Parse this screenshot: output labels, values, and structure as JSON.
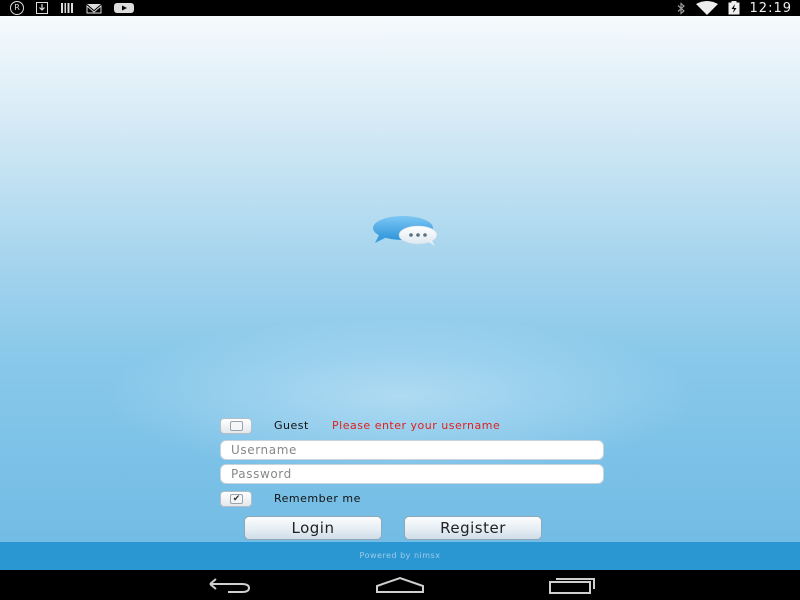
{
  "status_bar": {
    "time": "12:19",
    "left_icons": [
      "registered-icon",
      "download-icon",
      "barcode-icon",
      "mail-icon",
      "youtube-icon"
    ],
    "right_icons": [
      "bluetooth-icon",
      "wifi-icon",
      "battery-icon"
    ]
  },
  "form": {
    "guest_label": "Guest",
    "error_message": "Please enter your username",
    "username_placeholder": "Username",
    "password_placeholder": "Password",
    "remember_label": "Remember me",
    "guest_checked": false,
    "remember_checked": true,
    "login_label": "Login",
    "register_label": "Register"
  },
  "footer": {
    "powered_by": "Powered by nimsx"
  },
  "nav_bar": {
    "buttons": [
      "back-icon",
      "home-icon",
      "recent-apps-icon"
    ]
  },
  "colors": {
    "footer": "#2b97d2",
    "error": "#e0201c",
    "logo_bubble": "#4aa9e6"
  }
}
